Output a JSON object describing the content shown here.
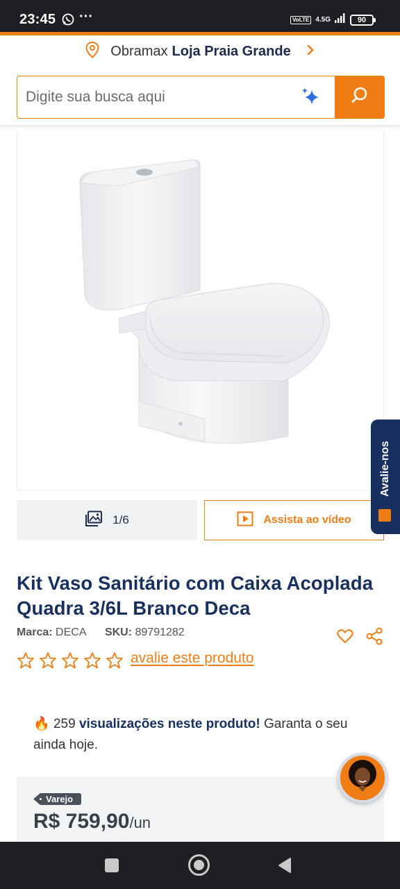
{
  "status_bar": {
    "time": "23:45",
    "dots": "···",
    "volte": "VoLTE",
    "network": "4.5G",
    "battery": "90"
  },
  "store": {
    "prefix": "Obramax",
    "name": "Loja Praia Grande"
  },
  "search": {
    "placeholder": "Digite sua busca aqui"
  },
  "gallery": {
    "counter": "1/6",
    "video_label": "Assista ao vídeo"
  },
  "side_tab": {
    "label": "Avalie-nos"
  },
  "product": {
    "title": "Kit Vaso Sanitário com Caixa Acoplada Quadra 3/6L Branco Deca",
    "brand_label": "Marca:",
    "brand": "DECA",
    "sku_label": "SKU:",
    "sku": "89791282",
    "rating_stars": 0,
    "rate_link": "avalie este produto"
  },
  "views": {
    "emoji": "🔥",
    "count": "259",
    "text_bold": "visualizações neste produto!",
    "text_rest": "Garanta o seu ainda hoje."
  },
  "price": {
    "tag": "Varejo",
    "value": "R$ 759,90",
    "unit": "/un"
  },
  "colors": {
    "accent": "#ef7d14",
    "navy": "#17305f",
    "status_bar": "#1e1f22"
  },
  "icons": [
    "whatsapp-icon",
    "location-pin-icon",
    "chevron-right-icon",
    "sparkle-icon",
    "search-icon",
    "gallery-image-icon",
    "play-icon",
    "heart-icon",
    "share-icon",
    "star-outline-icon",
    "fire-icon"
  ]
}
